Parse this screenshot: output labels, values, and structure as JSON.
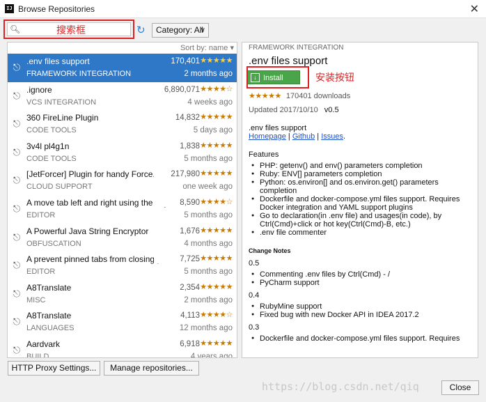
{
  "window": {
    "title": "Browse Repositories",
    "app_icon": "IJ",
    "close": "✕"
  },
  "toolbar": {
    "search_value": "",
    "search_annotation": "搜索框",
    "refresh": "↻",
    "category_label": "Category: All"
  },
  "list": {
    "sort_label": "Sort by: name ▾",
    "items": [
      {
        "name": ".env files support",
        "downloads": "170,401",
        "stars": "★★★★★",
        "category": "FRAMEWORK INTEGRATION",
        "date": "2 months ago"
      },
      {
        "name": ".ignore",
        "downloads": "6,890,071",
        "stars": "★★★★☆",
        "category": "VCS INTEGRATION",
        "date": "4 weeks ago"
      },
      {
        "name": "360 FireLine Plugin",
        "downloads": "14,832",
        "stars": "★★★★★",
        "category": "CODE TOOLS",
        "date": "5 days ago"
      },
      {
        "name": "3v4l pl4g1n",
        "downloads": "1,838",
        "stars": "★★★★★",
        "category": "CODE TOOLS",
        "date": "5 months ago"
      },
      {
        "name": "[JetForcer] Plugin for handy Force.com de",
        "downloads": "217,980",
        "stars": "★★★★★",
        "category": "CLOUD SUPPORT",
        "date": "one week ago"
      },
      {
        "name": "A move tab left and right using the keyboar",
        "downloads": "8,590",
        "stars": "★★★★☆",
        "category": "EDITOR",
        "date": "5 months ago"
      },
      {
        "name": "A Powerful Java String Encryptor",
        "downloads": "1,676",
        "stars": "★★★★★",
        "category": "OBFUSCATION",
        "date": "4 months ago"
      },
      {
        "name": "A prevent pinned tabs from closing plugin",
        "downloads": "7,725",
        "stars": "★★★★★",
        "category": "EDITOR",
        "date": "5 months ago"
      },
      {
        "name": "A8Translate",
        "downloads": "2,354",
        "stars": "★★★★★",
        "category": "MISC",
        "date": "2 months ago"
      },
      {
        "name": "A8Translate",
        "downloads": "4,113",
        "stars": "★★★★☆",
        "category": "LANGUAGES",
        "date": "12 months ago"
      },
      {
        "name": "Aardvark",
        "downloads": "6,918",
        "stars": "★★★★★",
        "category": "BUILD",
        "date": "4 years ago"
      }
    ]
  },
  "detail": {
    "category": "FRAMEWORK INTEGRATION",
    "name": ".env files support",
    "install_label": "Install",
    "install_annotation": "安装按钮",
    "stars": "★★★★★",
    "downloads": "170401 downloads",
    "updated": "Updated 2017/10/10",
    "version": "v0.5",
    "desc": ".env files support",
    "links": {
      "homepage": "Homepage",
      "github": "Github",
      "issues": "Issues"
    },
    "features_title": "Features",
    "features": [
      "PHP: getenv() and env() parameters completion",
      "Ruby: ENV[] parameters completion",
      "Python: os.environ[] and os.environ.get() parameters completion",
      "Dockerfile and docker-compose.yml files support. Requires Docker integration and YAML support plugins",
      "Go to declaration(in .env file) and usages(in code), by Ctrl(Cmd)+click or hot key(Ctrl(Cmd)-B, etc.)",
      ".env file commenter"
    ],
    "change_notes_title": "Change Notes",
    "versions": [
      {
        "label": "0.5",
        "items": [
          "Commenting .env files by Ctrl(Cmd) - /",
          "PyCharm support"
        ]
      },
      {
        "label": "0.4",
        "items": [
          "RubyMine support",
          "Fixed bug with new Docker API in IDEA 2017.2"
        ]
      },
      {
        "label": "0.3",
        "items": [
          "Dockerfile and docker-compose.yml files support. Requires"
        ]
      }
    ]
  },
  "footer": {
    "http_proxy": "HTTP Proxy Settings...",
    "manage_repos": "Manage repositories...",
    "close": "Close",
    "watermark": "https://blog.csdn.net/qiq"
  },
  "colors": {
    "selection": "#2f78c7",
    "install": "#4aa44a",
    "annotation": "#e02020",
    "stars": "#c87a00"
  }
}
